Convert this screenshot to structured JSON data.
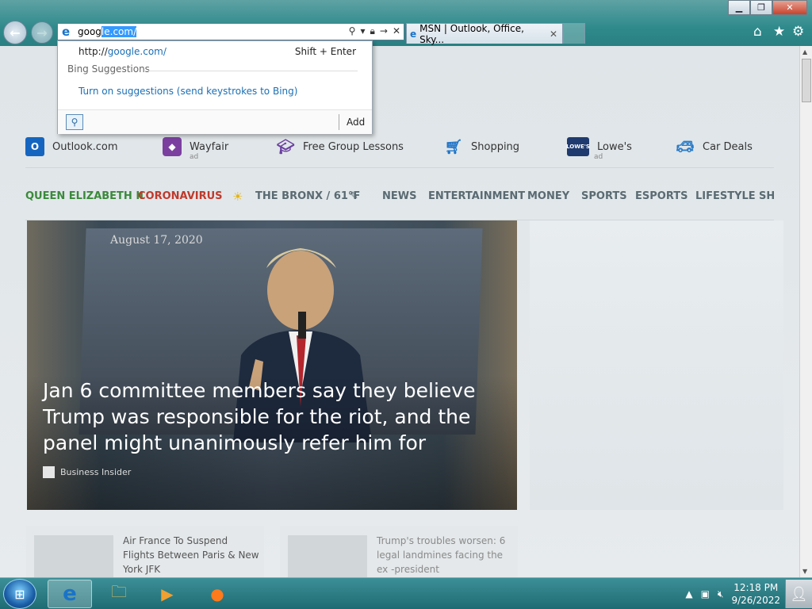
{
  "browser": {
    "address": {
      "prefix": "goog",
      "selected": "le.com/"
    },
    "tab_title": "MSN | Outlook, Office, Sky...",
    "icons": [
      "back-icon",
      "forward-icon",
      "search-icon",
      "lock-icon",
      "go-icon",
      "stop-icon",
      "home-icon",
      "favorites-icon",
      "tools-icon"
    ]
  },
  "dropdown": {
    "url": "http://google.com/",
    "url_prefix": "http://",
    "url_host": "google.com/",
    "shortcut": "Shift + Enter",
    "group_label": "Bing Suggestions",
    "suggestion_link": "Turn on suggestions (send keystrokes to Bing)",
    "add_label": "Add"
  },
  "quick_links": [
    {
      "label": "Outlook.com",
      "ad": ""
    },
    {
      "label": "Wayfair",
      "ad": "ad"
    },
    {
      "label": "Free Group Lessons",
      "ad": ""
    },
    {
      "label": "Shopping",
      "ad": ""
    },
    {
      "label": "Lowe's",
      "ad": "ad"
    },
    {
      "label": "Car Deals",
      "ad": ""
    }
  ],
  "nav": {
    "queen": "QUEEN ELIZABETH II",
    "corona": "CORONAVIRUS",
    "weather": "THE BRONX / 61°F",
    "items": [
      "NEWS",
      "ENTERTAINMENT",
      "MONEY",
      "SPORTS",
      "ESPORTS",
      "LIFESTYLE",
      "SH"
    ],
    "colors": {
      "queen": "#3a8a3a",
      "corona": "#c0392b",
      "default": "#5a6a72"
    }
  },
  "hero": {
    "date_on_screen": "August 17, 2020",
    "headline": "Jan 6 committee members say they believe Trump was responsible for the riot, and the panel might unanimously refer him for",
    "source": "Business Insider"
  },
  "cards": [
    {
      "title": "Air France To Suspend Flights Between Paris & New York JFK"
    },
    {
      "title": "Trump's troubles worsen: 6 legal landmines facing the ex -president"
    }
  ],
  "taskbar": {
    "time": "12:18 PM",
    "date": "9/26/2022"
  }
}
